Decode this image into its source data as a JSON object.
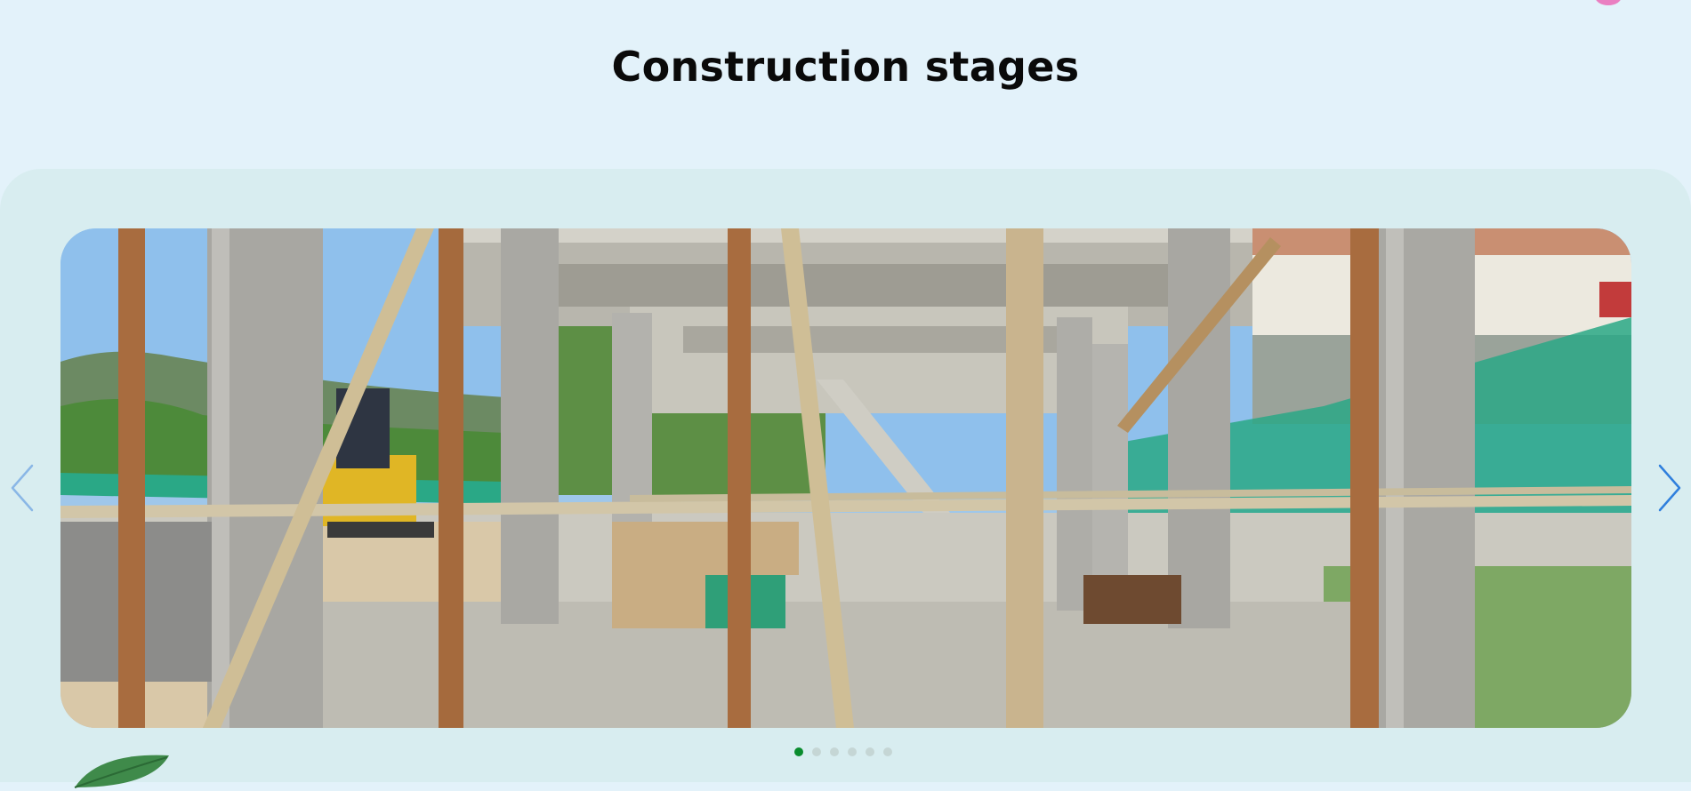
{
  "section": {
    "title": "Construction stages"
  },
  "carousel": {
    "current_slide": 1,
    "slide_count": 6,
    "slide_image": "photo-house-construction-concrete-columns-scaffolding",
    "prev_icon": "chevron-left-icon",
    "next_icon": "chevron-right-icon",
    "dots": [
      "1",
      "2",
      "3",
      "4",
      "5",
      "6"
    ]
  },
  "colors": {
    "page_background": "#e3f2fa",
    "panel_background": "#d8edf0",
    "accent_arrow": "#3f8fe0",
    "dot_active": "#0a8c2e",
    "dot_inactive": "#c5d6d5",
    "title_text": "#0a0a0a"
  },
  "decorations": {
    "leaf_icon": "leaf-icon",
    "petal_icon": "flower-petal-icon"
  }
}
